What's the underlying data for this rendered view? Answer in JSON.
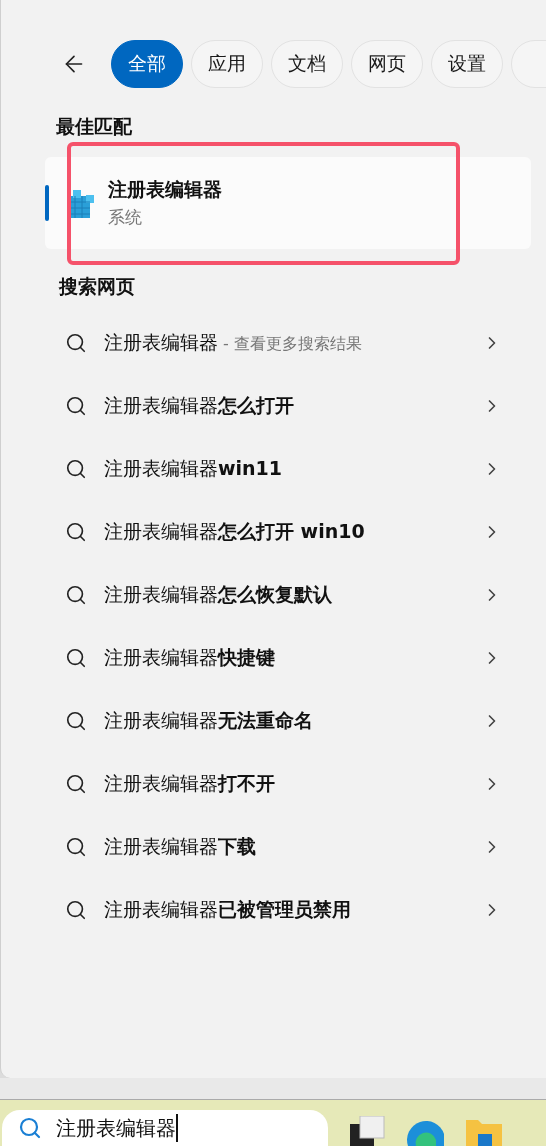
{
  "tabs": [
    {
      "label": "全部",
      "selected": true
    },
    {
      "label": "应用",
      "selected": false
    },
    {
      "label": "文档",
      "selected": false
    },
    {
      "label": "网页",
      "selected": false
    },
    {
      "label": "设置",
      "selected": false
    }
  ],
  "best_match": {
    "heading": "最佳匹配",
    "title": "注册表编辑器",
    "subtitle": "系统",
    "selected": true,
    "highlighted": true
  },
  "web_search": {
    "heading": "搜索网页",
    "items": [
      {
        "text": "注册表编辑器",
        "hint": " - 查看更多搜索结果"
      },
      {
        "text": "注册表编辑器**怎么打开**"
      },
      {
        "text": "注册表编辑器**win11**"
      },
      {
        "text": "注册表编辑器**怎么打开 win10**"
      },
      {
        "text": "注册表编辑器**怎么恢复默认**"
      },
      {
        "text": "注册表编辑器**快捷键**"
      },
      {
        "text": "注册表编辑器**无法重命名**"
      },
      {
        "text": "注册表编辑器**打不开**"
      },
      {
        "text": "注册表编辑器**下载**"
      },
      {
        "text": "注册表编辑器**已被管理员禁用**"
      }
    ]
  },
  "taskbar": {
    "search": {
      "value": "注册表编辑器"
    }
  }
}
